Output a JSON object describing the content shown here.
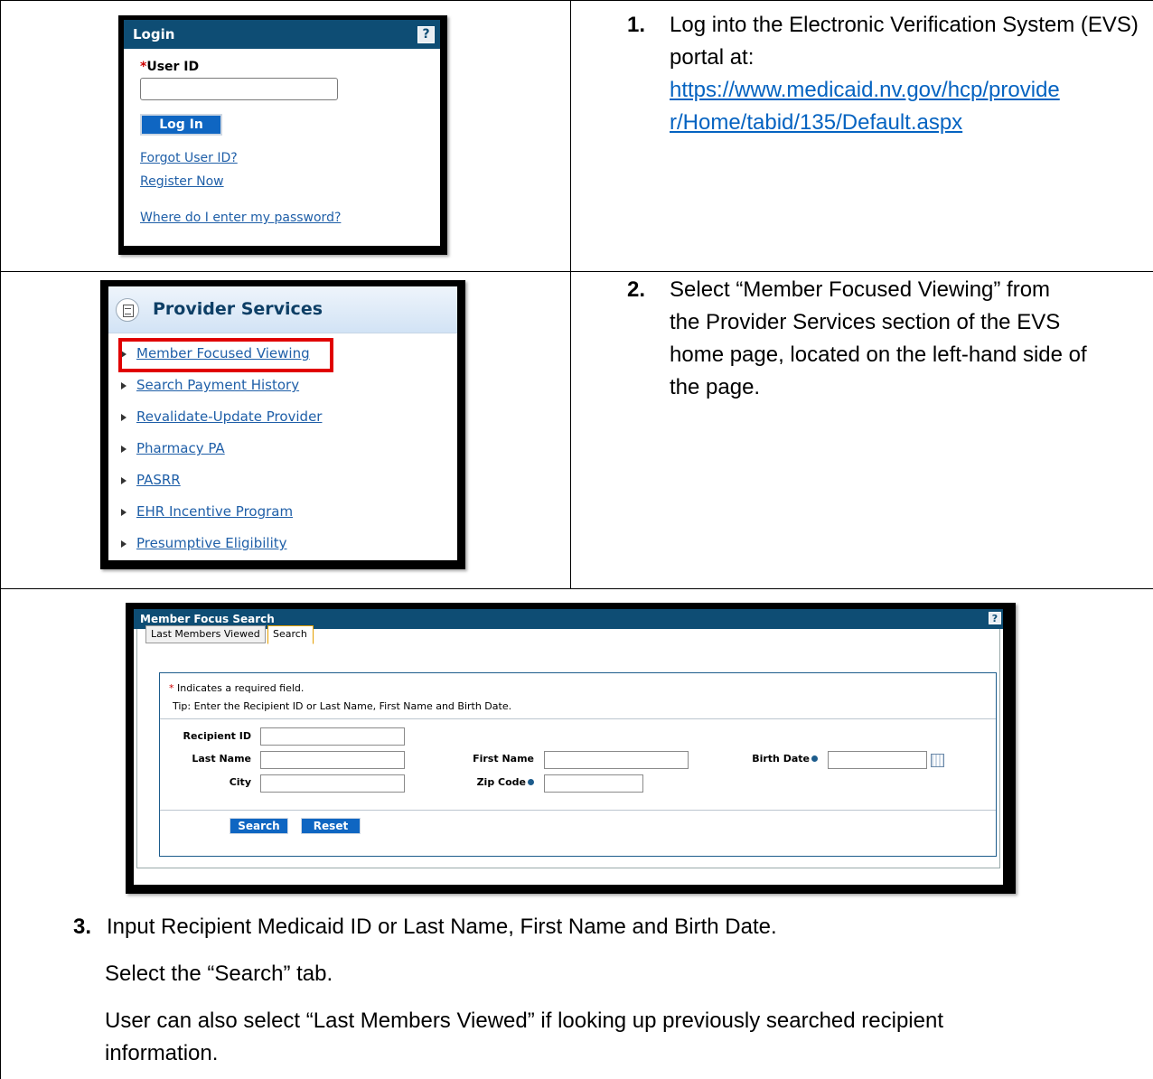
{
  "step1": {
    "number": "1.",
    "text": "Log into the Electronic Verification System (EVS) portal at:",
    "url_line1": "https://www.medicaid.nv.gov/hcp/provide",
    "url_line2": "r/Home/tabid/135/Default.aspx"
  },
  "login": {
    "title": "Login",
    "help": "?",
    "required_mark": "*",
    "user_id_label": "User ID",
    "user_id_value": "",
    "login_button": "Log In",
    "forgot_link": "Forgot User ID?",
    "register_link": "Register Now",
    "password_link": "Where do I enter my password?"
  },
  "step2": {
    "number": "2.",
    "line1": "Select “Member Focused Viewing” from",
    "line2": "the Provider Services section of the EVS",
    "line3": "home page, located on the left-hand side of",
    "line4": "the page."
  },
  "provider_services": {
    "title": "Provider Services",
    "items": [
      "Member Focused Viewing",
      "Search Payment History",
      "Revalidate-Update Provider",
      "Pharmacy PA",
      "PASRR",
      "EHR Incentive Program",
      "Presumptive Eligibility"
    ]
  },
  "member_search": {
    "title": "Member Focus Search",
    "help": "?",
    "tabs": [
      "Last Members Viewed",
      "Search"
    ],
    "required_mark": "*",
    "required_note": " Indicates a required field.",
    "tip": "Tip: Enter the Recipient ID or Last Name, First Name and Birth Date.",
    "labels": {
      "recipient_id": "Recipient ID",
      "last_name": "Last Name",
      "first_name": "First Name",
      "birth_date": "Birth Date",
      "city": "City",
      "zip_code": "Zip Code"
    },
    "values": {
      "recipient_id": "",
      "last_name": "",
      "first_name": "",
      "birth_date": "",
      "city": "",
      "zip_code": ""
    },
    "search_button": "Search",
    "reset_button": "Reset"
  },
  "step3": {
    "number": "3.",
    "line1": "Input Recipient Medicaid ID or Last Name, First Name and Birth Date.",
    "line2": "Select the “Search” tab.",
    "line3": "User can also select “Last Members Viewed” if looking up previously searched recipient",
    "line4": "information."
  }
}
